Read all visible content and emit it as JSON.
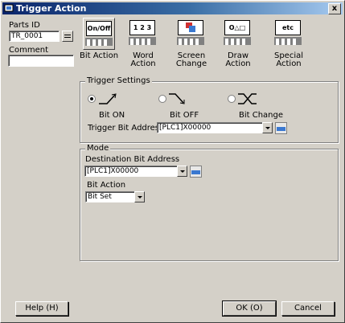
{
  "window": {
    "title": "Trigger Action",
    "close_label": "x"
  },
  "parts_id": {
    "label": "Parts ID",
    "value": "TR_0001"
  },
  "comment": {
    "label": "Comment",
    "value": ""
  },
  "toolbar": [
    {
      "face": "On/Off",
      "label": "Bit Action"
    },
    {
      "face": "1 2 3",
      "label": "Word Action"
    },
    {
      "face": "",
      "label": "Screen Change"
    },
    {
      "face": "O△□",
      "label": "Draw Action"
    },
    {
      "face": "etc",
      "label": "Special Action"
    }
  ],
  "trigger": {
    "title": "Trigger Settings",
    "options": [
      "Bit ON",
      "Bit OFF",
      "Bit Change"
    ],
    "selected": "Bit ON",
    "address_label": "Trigger Bit Address",
    "address_value": "[PLC1]X00000"
  },
  "mode": {
    "title": "Mode",
    "dest_label": "Destination Bit Address",
    "dest_value": "[PLC1]X00000",
    "action_label": "Bit Action",
    "action_value": "Bit Set"
  },
  "buttons": {
    "help": "Help (H)",
    "ok": "OK (O)",
    "cancel": "Cancel"
  }
}
